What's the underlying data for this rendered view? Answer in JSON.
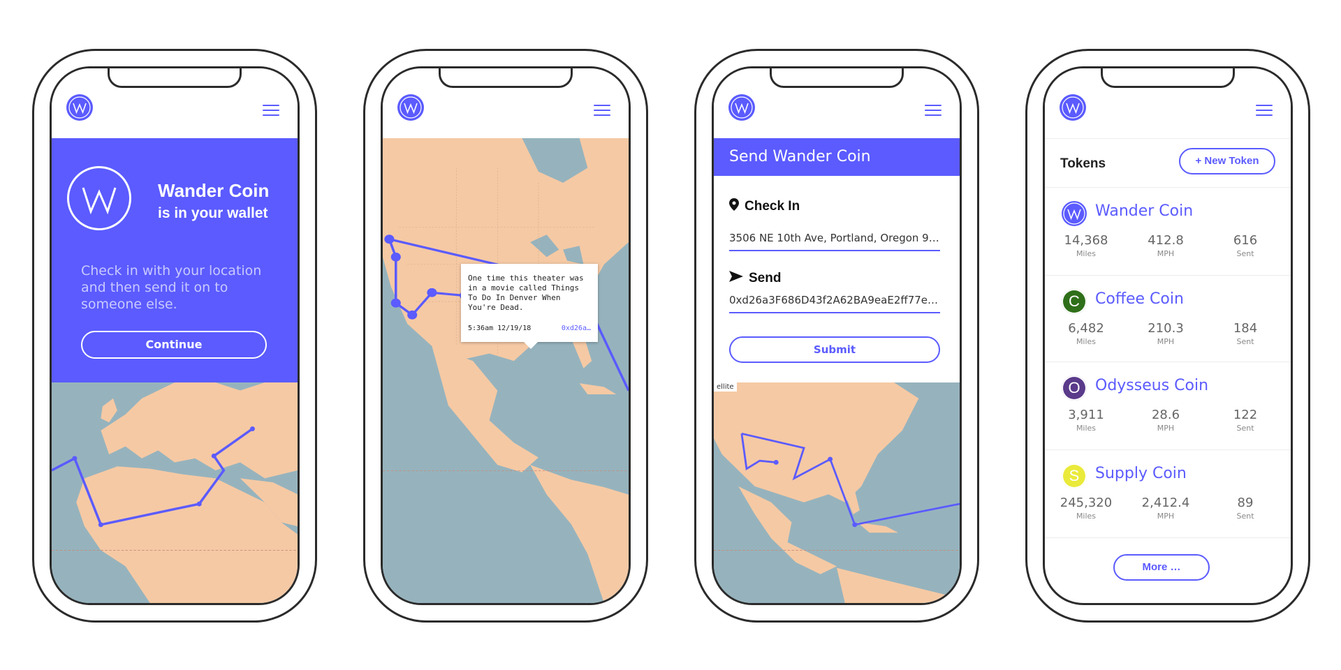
{
  "colors": {
    "accent": "#5b5bff",
    "land": "#f5c9a4",
    "water": "#96b3bd"
  },
  "phone1": {
    "title": "Wander Coin",
    "subtitle": "is in your wallet",
    "description": "Check in with your location and then send it on to someone else.",
    "continue_label": "Continue"
  },
  "phone2": {
    "tooltip_text": "One time this theater was in a movie called Things To Do In Denver When You're Dead.",
    "tooltip_time": "5:36am 12/19/18",
    "tooltip_hash": "0xd26a…"
  },
  "phone3": {
    "header_title": "Send Wander Coin",
    "checkin_label": "Check In",
    "checkin_value": "3506 NE 10th Ave, Portland, Oregon 972…",
    "send_label": "Send",
    "send_value": "0xd26a3F686D43f2A62BA9eaE2ff77eb8…",
    "submit_label": "Submit",
    "map_tag": "ellite"
  },
  "phone4": {
    "tokens_title": "Tokens",
    "new_token_label": "New Token",
    "more_label": "More …",
    "tokens": [
      {
        "name": "Wander Coin",
        "initial": "",
        "icon_color": "#5b5bff",
        "miles": "14,368",
        "mph": "412.8",
        "sent": "616"
      },
      {
        "name": "Coffee Coin",
        "initial": "C",
        "icon_color": "#2f6f1a",
        "miles": "6,482",
        "mph": "210.3",
        "sent": "184"
      },
      {
        "name": "Odysseus Coin",
        "initial": "O",
        "icon_color": "#5a3a8a",
        "miles": "3,911",
        "mph": "28.6",
        "sent": "122"
      },
      {
        "name": "Supply Coin",
        "initial": "S",
        "icon_color": "#eaea3a",
        "miles": "245,320",
        "mph": "2,412.4",
        "sent": "89"
      }
    ],
    "stat_labels": {
      "miles": "Miles",
      "mph": "MPH",
      "sent": "Sent"
    }
  }
}
